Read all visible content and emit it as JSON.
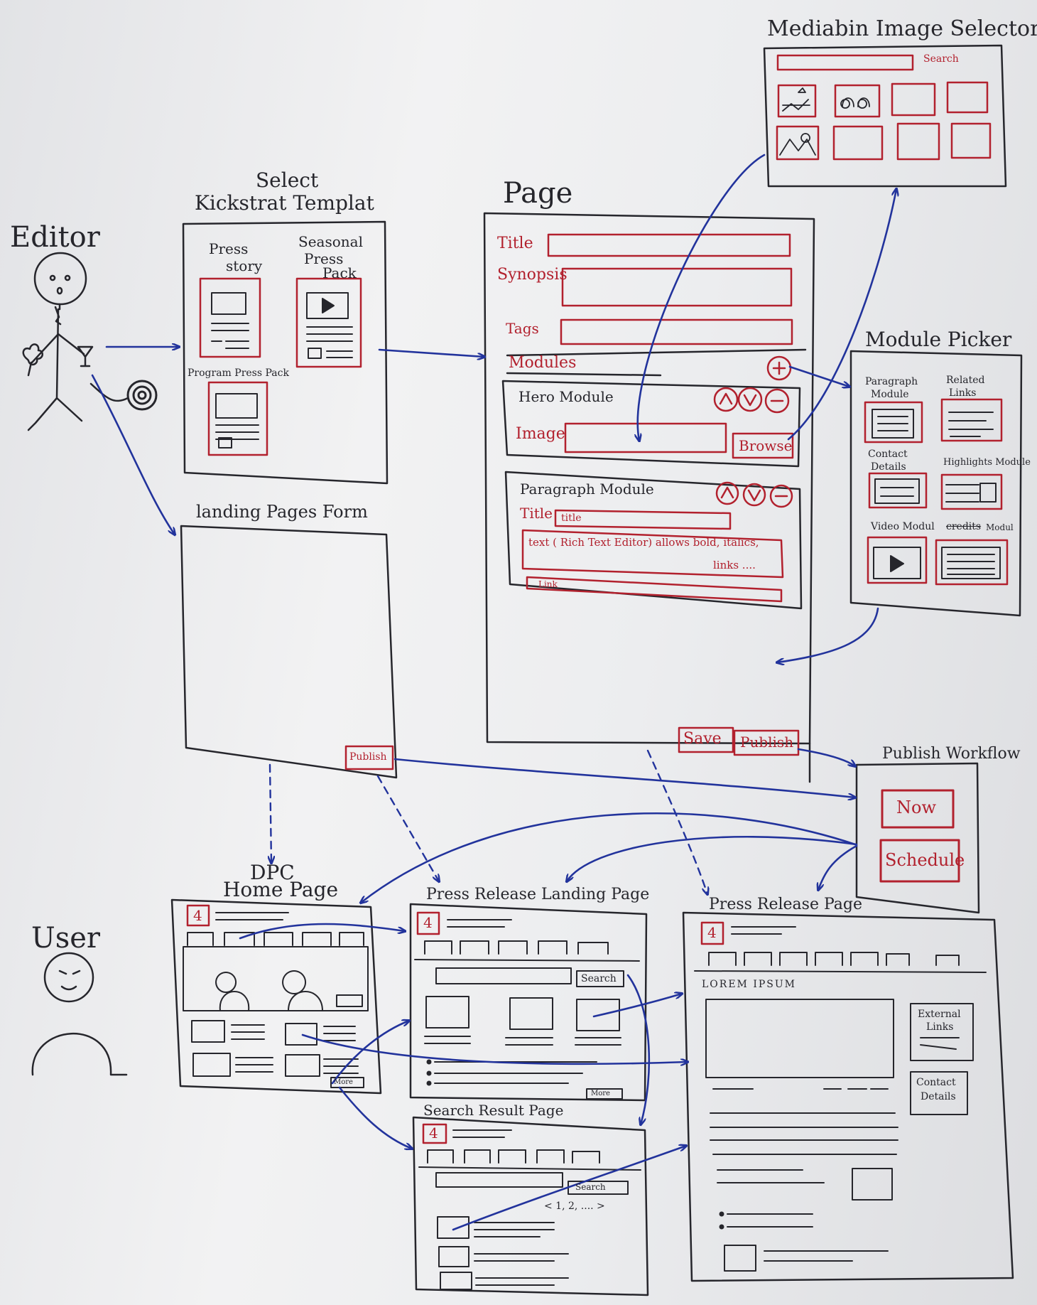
{
  "colors": {
    "ink": "#26262c",
    "red": "#b2212e",
    "blue": "#22339c",
    "paper": "#ececee"
  },
  "actors": {
    "editor": "Editor",
    "user": "User"
  },
  "template_picker": {
    "title_line1": "Select",
    "title_line2": "Kickstrat Templat",
    "press_story_line1": "Press",
    "press_story_line2": "story",
    "seasonal_line1": "Seasonal",
    "seasonal_line2": "Press",
    "seasonal_line3": "Pack",
    "program": "Program Press Pack"
  },
  "landing_form": {
    "title": "landing Pages Form",
    "publish": "Publish"
  },
  "page": {
    "title": "Page",
    "title_label": "Title",
    "synopsis_label": "Synopsis",
    "tags_label": "Tags",
    "modules_label": "Modules",
    "hero": {
      "title": "Hero Module",
      "image_label": "Image",
      "browse": "Browse"
    },
    "paragraph": {
      "title": "Paragraph Module",
      "title_label": "Title",
      "title_value": "title",
      "text_line1": "text  ( Rich Text Editor)  allows  bold, italics,",
      "text_line2": "links ....",
      "link": "Link"
    },
    "save": "Save",
    "publish": "Publish"
  },
  "image_selector": {
    "title": "Mediabin Image Selector",
    "search": "Search"
  },
  "module_picker": {
    "title": "Module  Picker",
    "paragraph_line1": "Paragraph",
    "paragraph_line2": "Module",
    "related_line1": "Related",
    "related_line2": "Links",
    "contact_line1": "Contact",
    "contact_line2": "Details",
    "highlights": "Highlights Module",
    "video": "Video Modul",
    "credits": "credits",
    "credits_suffix": "Modul"
  },
  "publish_workflow": {
    "title": "Publish Workflow",
    "now": "Now",
    "schedule": "Schedule"
  },
  "home_page": {
    "title_line1": "DPC",
    "title_line2": "Home Page",
    "logo": "4",
    "more": "More"
  },
  "landing_page": {
    "title": "Press Release Landing Page",
    "logo": "4",
    "search": "Search",
    "more": "More"
  },
  "search_results": {
    "title": "Search Result Page",
    "logo": "4",
    "search": "Search",
    "pagination": "< 1, 2, .... >"
  },
  "release_page": {
    "title": "Press Release  Page",
    "logo": "4",
    "heading": "LOREM IPSUM",
    "external_line1": "External",
    "external_line2": "Links",
    "contact_line1": "Contact",
    "contact_line2": "Details"
  }
}
